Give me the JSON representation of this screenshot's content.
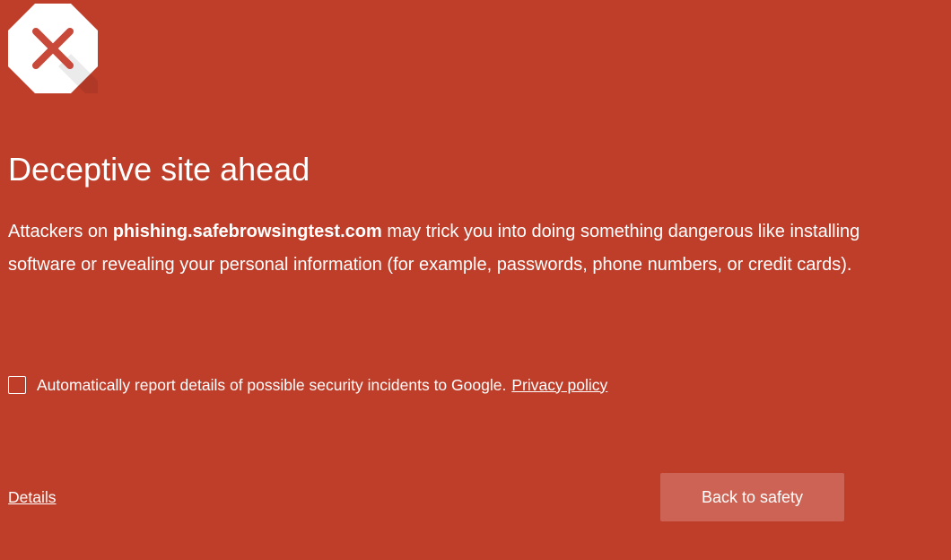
{
  "colors": {
    "background": "#BE3E2A",
    "button_background": "#CC6354",
    "text": "#FFFFFF",
    "icon_x": "#C8483A"
  },
  "icon": {
    "name": "warning-octagon-x-icon"
  },
  "warning": {
    "title": "Deceptive site ahead",
    "message": {
      "prefix": "Attackers on ",
      "domain": "phishing.safebrowsingtest.com",
      "suffix": " may trick you into doing something dangerous like installing software or revealing your personal information (for example, passwords, phone numbers, or credit cards)."
    }
  },
  "report": {
    "checked": false,
    "label": "Automatically report details of possible security incidents to Google.",
    "privacy_link": "Privacy policy"
  },
  "actions": {
    "details_link": "Details",
    "back_button": "Back to safety"
  }
}
